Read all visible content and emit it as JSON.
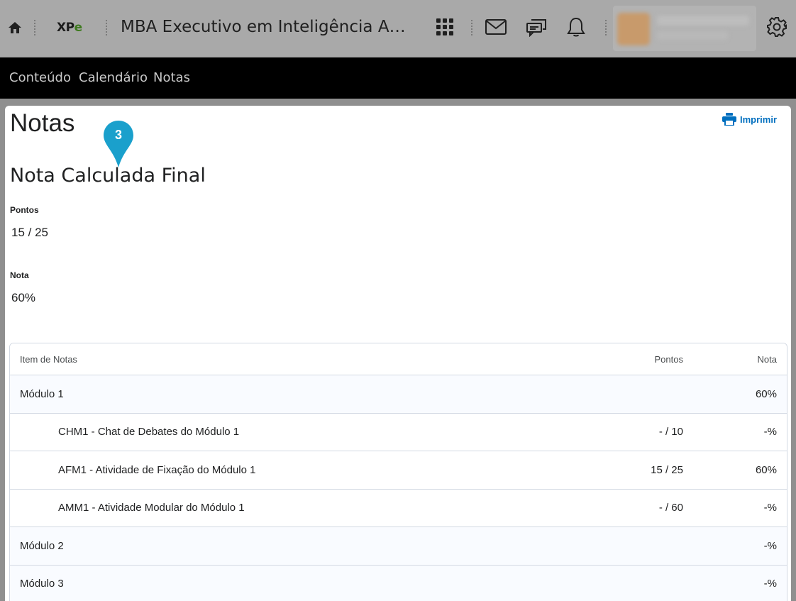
{
  "header": {
    "logo_text_a": "XP",
    "logo_text_b": "e",
    "course_title": "MBA Executivo em Inteligência Artificial",
    "icons": [
      "home-icon",
      "waffle-icon",
      "mail-icon",
      "chat-icon",
      "bell-icon",
      "gear-icon"
    ]
  },
  "nav": {
    "items": [
      "Conteúdo",
      "Calendário",
      "Notas"
    ]
  },
  "page": {
    "title": "Notas",
    "print_label": "Imprimir",
    "marker_number": "3",
    "final_section_title": "Nota Calculada Final",
    "points_label": "Pontos",
    "points_value": "15 / 25",
    "grade_label": "Nota",
    "grade_value": "60%"
  },
  "table": {
    "columns": [
      "Item de Notas",
      "Pontos",
      "Nota"
    ],
    "rows": [
      {
        "type": "module",
        "name": "Módulo 1",
        "points": "",
        "grade": "60%"
      },
      {
        "type": "item",
        "name": "CHM1 - Chat de Debates do Módulo 1",
        "points": "- / 10",
        "grade": "-%"
      },
      {
        "type": "item",
        "name": "AFM1 - Atividade de Fixação do Módulo 1",
        "points": "15 / 25",
        "grade": "60%"
      },
      {
        "type": "item",
        "name": "AMM1 - Atividade Modular do Módulo 1",
        "points": "- / 60",
        "grade": "-%"
      },
      {
        "type": "module",
        "name": "Módulo 2",
        "points": "",
        "grade": "-%"
      },
      {
        "type": "module",
        "name": "Módulo 3",
        "points": "",
        "grade": "-%"
      }
    ]
  },
  "colors": {
    "link": "#006fbf",
    "marker": "#1aa0cc",
    "nav_bg": "#000000",
    "module_row_bg": "#f9fbff"
  }
}
